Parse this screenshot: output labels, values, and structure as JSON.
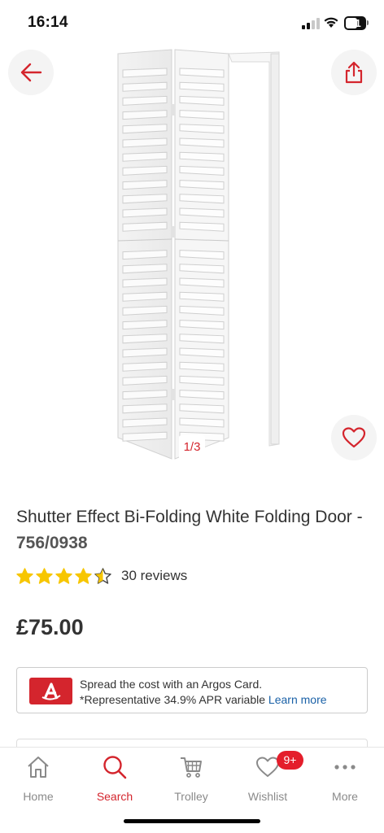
{
  "status_bar": {
    "time": "16:14",
    "battery": "61"
  },
  "image": {
    "counter": "1/3"
  },
  "product": {
    "title": "Shutter Effect Bi-Folding White Folding Door - ",
    "code": "756/0938",
    "rating": 4.5,
    "reviews": "30 reviews",
    "price": "£75.00"
  },
  "argos_card": {
    "line1": "Spread the cost with an Argos Card.",
    "line2": "*Representative 34.9% APR variable ",
    "link": "Learn more"
  },
  "nav": {
    "items": [
      {
        "label": "Home",
        "icon": "home-icon"
      },
      {
        "label": "Search",
        "icon": "search-icon"
      },
      {
        "label": "Trolley",
        "icon": "trolley-icon"
      },
      {
        "label": "Wishlist",
        "icon": "heart-icon"
      },
      {
        "label": "More",
        "icon": "more-icon"
      }
    ],
    "active": "Search",
    "wishlist_badge": "9+"
  },
  "colors": {
    "brand_red": "#d4252d",
    "link_blue": "#1a61a7",
    "star_yellow": "#f7c600"
  }
}
